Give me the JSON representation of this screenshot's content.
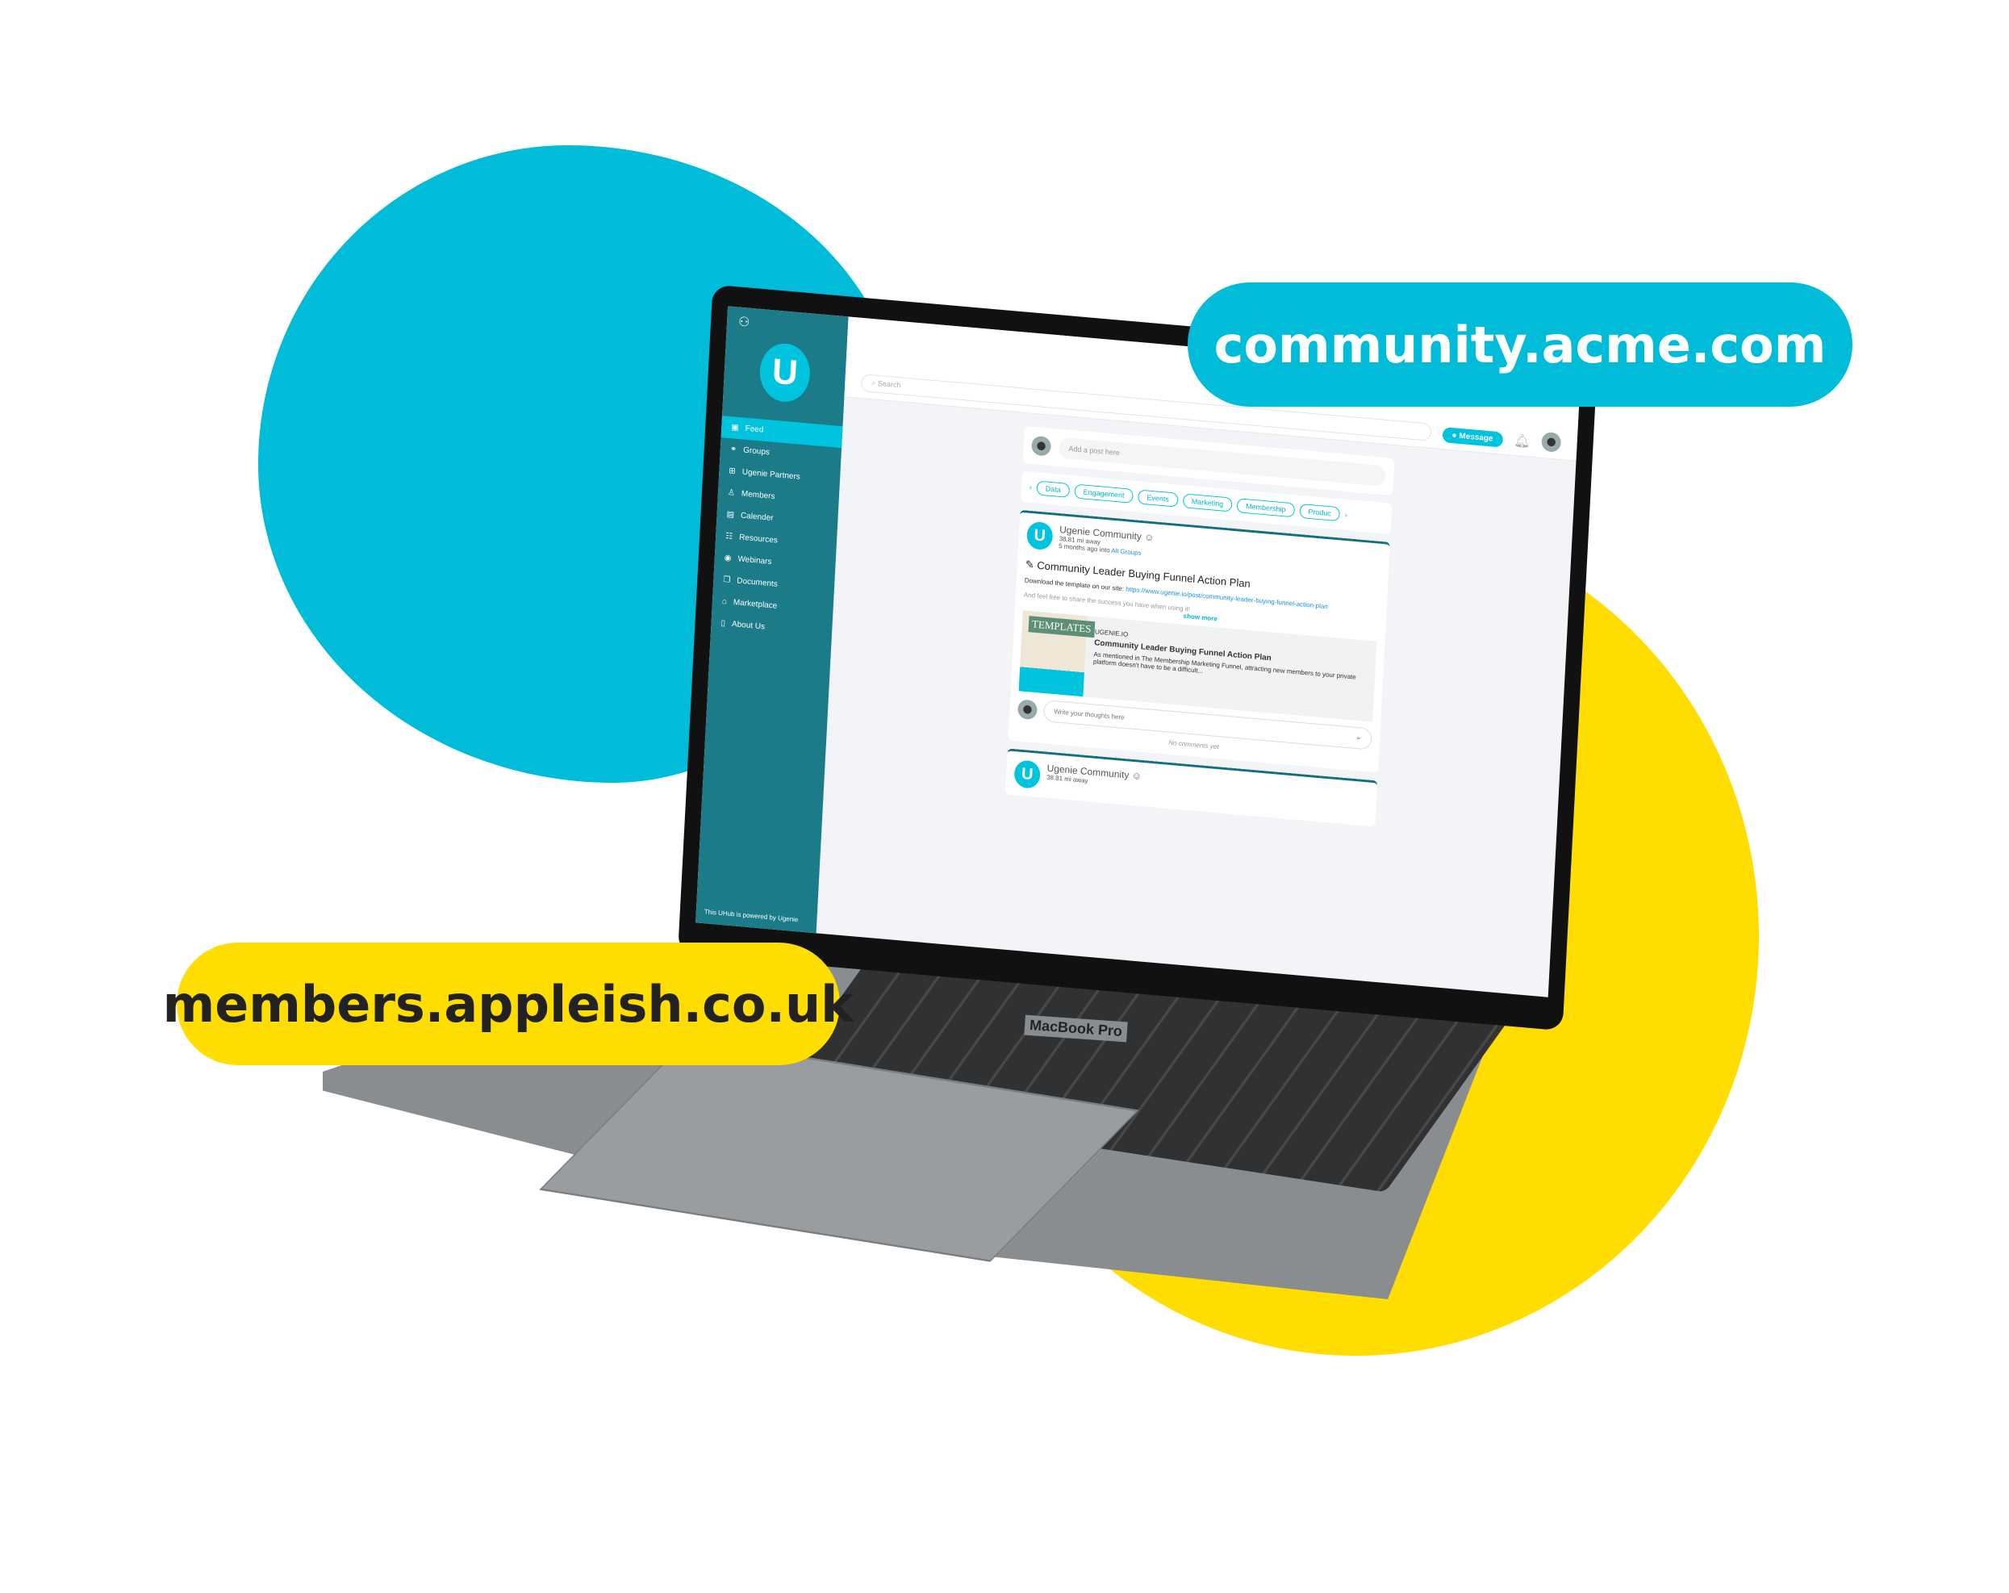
{
  "colors": {
    "cyan": "#00bcd9",
    "yellow": "#ffdd00",
    "sidebar": "#1b7b89",
    "accent": "#00c3de"
  },
  "labels": {
    "domain_top": "community.acme.com",
    "domain_bottom": "members.appleish.co.uk",
    "laptop_brand": "MacBook Pro"
  },
  "sidebar": {
    "logo": "U",
    "items": [
      {
        "label": "Feed",
        "icon": "feed-icon",
        "active": true
      },
      {
        "label": "Groups",
        "icon": "groups-icon"
      },
      {
        "label": "Ugenie Partners",
        "icon": "gift-icon"
      },
      {
        "label": "Members",
        "icon": "person-icon"
      },
      {
        "label": "Calender",
        "icon": "calendar-icon"
      },
      {
        "label": "Resources",
        "icon": "resources-icon"
      },
      {
        "label": "Webinars",
        "icon": "play-icon"
      },
      {
        "label": "Documents",
        "icon": "documents-icon"
      },
      {
        "label": "Marketplace",
        "icon": "store-icon"
      },
      {
        "label": "About Us",
        "icon": "book-icon"
      }
    ],
    "powered": "This UHub is powered by Ugenie"
  },
  "topbar": {
    "search_placeholder": "Search",
    "message": "Message"
  },
  "composer": {
    "placeholder": "Add a post here"
  },
  "chips": [
    "Data",
    "Engagement",
    "Events",
    "Marketing",
    "Membership",
    "Produc"
  ],
  "post": {
    "author": "Ugenie Community",
    "distance": "38.81 mi away",
    "time": "5 months ago into",
    "group": "All Groups",
    "title": "Community Leader Buying Funnel Action Plan",
    "body": "Download the template on our site:",
    "url": "https://www.ugenie.io/post/community-leader-buying-funnel-action-plan",
    "extra": "And feel free to share the success you have when using it!",
    "show_more": "show more",
    "preview": {
      "thumb": "TEMPLATES",
      "site": "UGENIE.IO",
      "title": "Community Leader Buying Funnel Action Plan",
      "desc": "As mentioned in The Membership Marketing Funnel, attracting new members to your private platform doesn't have to be a difficult..."
    },
    "comment_placeholder": "Write your thoughts here",
    "no_comments": "No comments yet"
  },
  "post2": {
    "author": "Ugenie Community",
    "distance": "38.81 mi away"
  }
}
